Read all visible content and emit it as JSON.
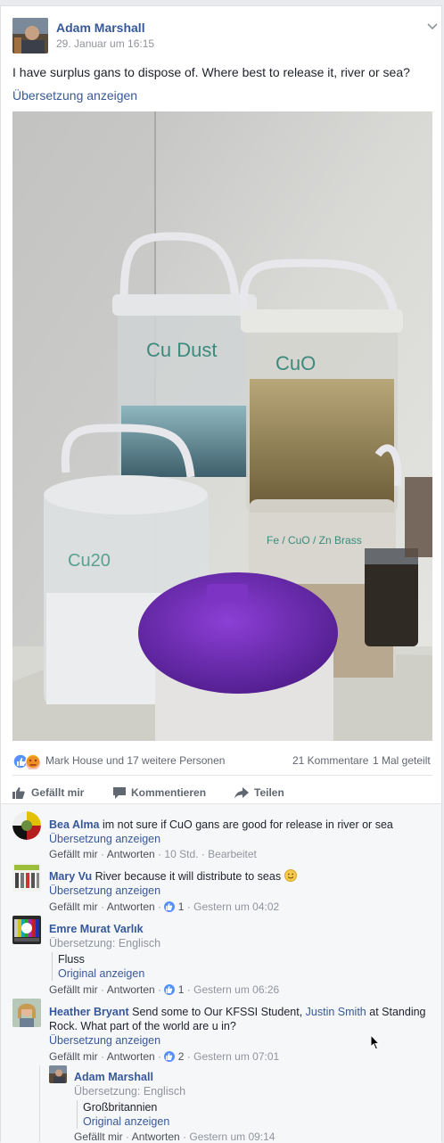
{
  "post": {
    "author": "Adam Marshall",
    "timestamp": "29. Januar um 16:15",
    "text": "I have surplus gans to dispose of. Where best to release it, river or sea?",
    "translate_link": "Übersetzung anzeigen",
    "reactions_text": "Mark House und 17 weitere Personen",
    "comments_count": "21 Kommentare",
    "shares_count": "1 Mal geteilt",
    "image_labels": {
      "left_top_jar": "Cu Dust",
      "right_top_jar": "CuO",
      "left_bottom_jar": "Cu20",
      "right_bottom_jar": "Fe / CuO / Zn Brass"
    }
  },
  "actions": {
    "like": "Gefällt mir",
    "comment": "Kommentieren",
    "share": "Teilen"
  },
  "comments": [
    {
      "author": "Bea Alma",
      "text": "im not sure if CuO gans are good for release in river or sea",
      "translate": "Übersetzung anzeigen",
      "like": "Gefällt mir",
      "reply": "Antworten",
      "time": "10 Std.",
      "edited": "Bearbeitet"
    },
    {
      "author": "Mary Vu",
      "text": "River because it will distribute to seas",
      "translate": "Übersetzung anzeigen",
      "like": "Gefällt mir",
      "reply": "Antworten",
      "likes": "1",
      "time": "Gestern um 04:02"
    },
    {
      "author": "Emre Murat Varlık",
      "translation_label": "Übersetzung: Englisch",
      "translated_text": "Fluss",
      "original_link": "Original anzeigen",
      "like": "Gefällt mir",
      "reply": "Antworten",
      "likes": "1",
      "time": "Gestern um 06:26"
    },
    {
      "author": "Heather Bryant",
      "text_before": "Send some to Our KFSSI Student,",
      "mention": "Justin Smith",
      "text_after": "at Standing",
      "text_line2": "Rock. What part of the world are u in?",
      "translate": "Übersetzung anzeigen",
      "like": "Gefällt mir",
      "reply": "Antworten",
      "likes": "2",
      "time": "Gestern um 07:01"
    }
  ],
  "reply": {
    "author": "Adam Marshall",
    "translation_label": "Übersetzung: Englisch",
    "translated_text": "Großbritannien",
    "original_link": "Original anzeigen",
    "like": "Gefällt mir",
    "reply": "Antworten",
    "time": "Gestern um 09:14"
  },
  "separator": "·",
  "colors": {
    "link": "#365899",
    "like_blue": "#5890ff",
    "angry": "#f0ba15",
    "purple_lid": "#6b2bb0"
  }
}
